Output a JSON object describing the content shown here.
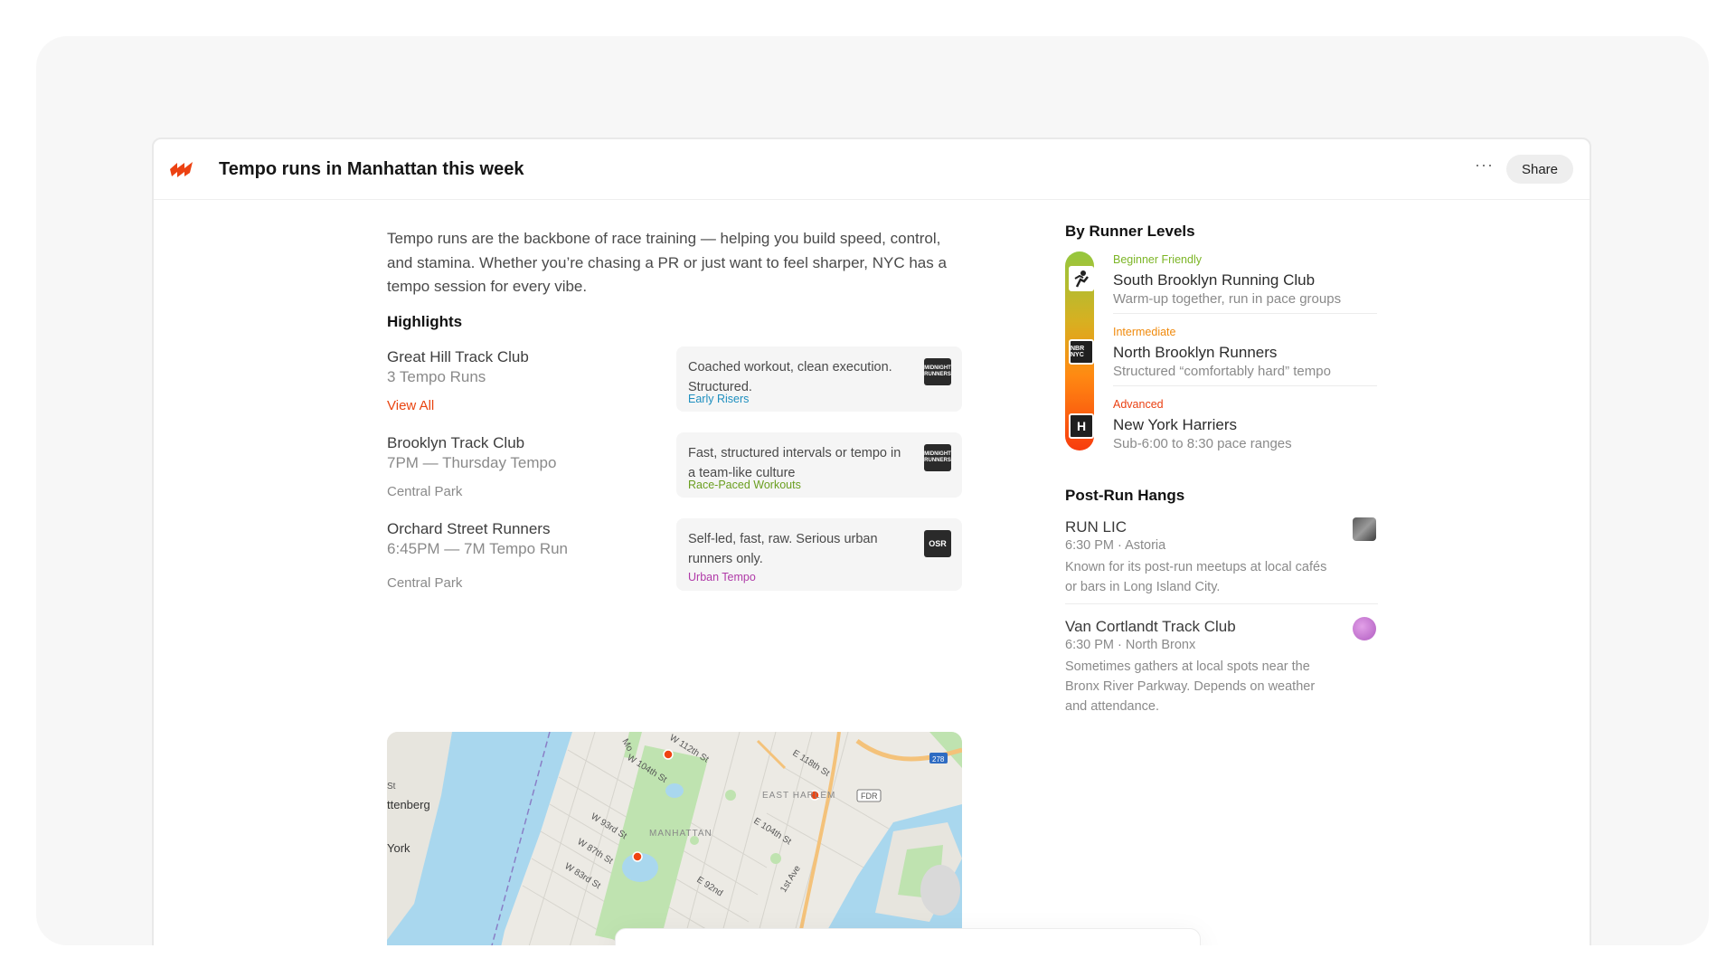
{
  "header": {
    "title": "Tempo runs in Manhattan this week",
    "more_label": "···",
    "share_label": "Share"
  },
  "intro": "Tempo runs are the backbone of race training — helping you build speed, control, and stamina. Whether you’re chasing a PR or just want to feel sharper, NYC has a tempo session for every vibe.",
  "highlights": {
    "title": "Highlights",
    "items": [
      {
        "club": "Great Hill Track Club",
        "sub": "3 Tempo Runs",
        "link": "View All",
        "card_text": "Coached workout, clean execution. Structured.",
        "tag": "Early Risers",
        "tag_color": "#1e8fbf",
        "logo_text": "MIDNIGHT RUNNERS"
      },
      {
        "club": "Brooklyn Track Club",
        "sub": "7PM — Thursday Tempo",
        "meta": "Central Park",
        "card_text": "Fast, structured intervals or tempo in a team-like culture",
        "tag": "Race-Paced Workouts",
        "tag_color": "#6a9e1f",
        "logo_text": "MIDNIGHT RUNNERS"
      },
      {
        "club": "Orchard Street Runners",
        "sub": "6:45PM — 7M Tempo Run",
        "meta": "Central Park",
        "card_text": "Self-led, fast, raw. Serious urban runners only.",
        "tag": "Urban Tempo",
        "tag_color": "#b03aa8",
        "logo_text": "OSR"
      }
    ]
  },
  "map": {
    "labels": [
      "W 104th St",
      "W 112th St",
      "E 118th St",
      "EAST HARLEM",
      "FDR",
      "W 93rd St",
      "E 104th St",
      "MANHATTAN",
      "W 87th St",
      "W 83rd St",
      "1st Ave",
      "E 92nd",
      "ttenberg",
      "York",
      "St",
      "278",
      "Mo"
    ]
  },
  "levels": {
    "title": "By Runner Levels",
    "items": [
      {
        "tag": "Beginner Friendly",
        "tag_color": "#7cb526",
        "name": "South Brooklyn Running Club",
        "desc": "Warm-up together, run in pace groups",
        "icon": "runner-icon"
      },
      {
        "tag": "Intermediate",
        "tag_color": "#f08a0c",
        "name": "North Brooklyn Runners",
        "desc": "Structured “comfortably hard” tempo",
        "icon_text": "NBR NYC",
        "icon": "nbr-logo-icon"
      },
      {
        "tag": "Advanced",
        "tag_color": "#ea4012",
        "name": "New York Harriers",
        "desc": "Sub-6:00 to 8:30 pace ranges",
        "icon_text": "H",
        "icon": "harriers-logo-icon"
      }
    ]
  },
  "hangs": {
    "title": "Post-Run Hangs",
    "items": [
      {
        "name": "RUN LIC",
        "meta": "6:30 PM · Astoria",
        "desc": "Known for its post-run meetups at local cafés or bars in Long Island City."
      },
      {
        "name": "Van Cortlandt Track Club",
        "meta": "6:30 PM · North Bronx",
        "desc": "Sometimes gathers at local spots near the Bronx River Parkway. Depends on weather  and attendance."
      }
    ]
  },
  "ask": {
    "placeholder": "Tempo runs in Manhattan this week"
  },
  "colors": {
    "accent": "#e9400f"
  }
}
